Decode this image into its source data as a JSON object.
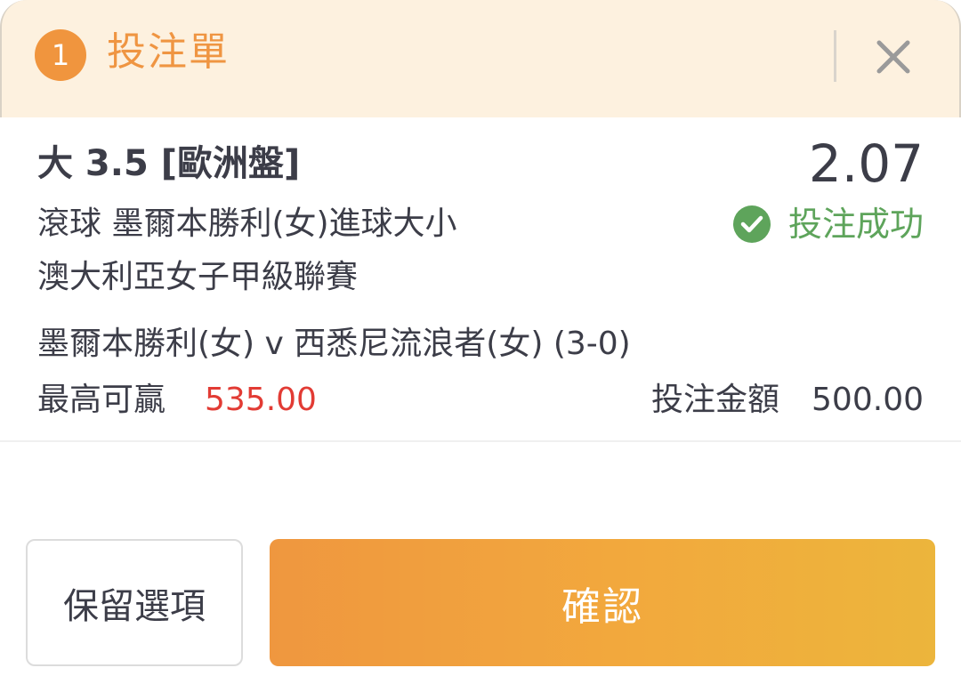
{
  "header": {
    "count": "1",
    "title": "投注單"
  },
  "bet": {
    "selection": "大 3.5 [歐洲盤]",
    "odds": "2.07",
    "market": "滾球 墨爾本勝利(女)進球大小",
    "status": "投注成功",
    "league": "澳大利亞女子甲級聯賽",
    "match": "墨爾本勝利(女) v 西悉尼流浪者(女) (3-0)",
    "max_win_label": "最高可贏",
    "max_win_value": "535.00",
    "stake_label": "投注金額",
    "stake_value": "500.00"
  },
  "buttons": {
    "keep": "保留選項",
    "confirm": "確認"
  },
  "icons": {
    "close": "close-icon",
    "status": "check-circle-icon"
  },
  "colors": {
    "accent": "#ef9542",
    "success": "#5ea45b",
    "win": "#e23b34",
    "header_bg": "#fdf1df"
  }
}
